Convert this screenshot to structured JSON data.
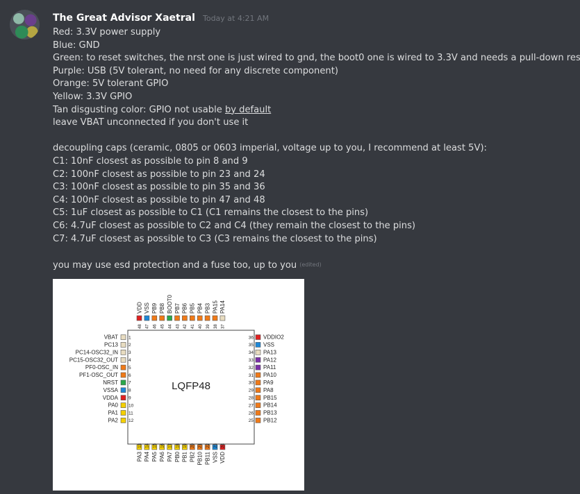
{
  "message": {
    "author": "The Great Advisor Xaetral",
    "timestamp": "Today at 4:21 AM",
    "lines": [
      "Red: 3.3V power supply",
      "Blue: GND",
      "Green: to reset switches, the nrst one is just wired to gnd, the boot0 one is wired to 3.3V and needs a pull-down resistor",
      "Purple: USB (5V tolerant, no need for any discrete component)",
      "Orange: 5V tolerant GPIO",
      "Yellow: 3.3V GPIO"
    ],
    "tan_line_prefix": "Tan disgusting color: GPIO not usable ",
    "tan_line_link": "by default",
    "vbat_line": "leave VBAT unconnected if you don't use it",
    "caps_lines": [
      "decoupling caps (ceramic, 0805 or 0603 imperial, voltage up to you, I recommend at least 5V):",
      "C1: 10nF closest as possible to pin 8 and 9",
      "C2: 100nF closest as possible to pin 23 and 24",
      "C3: 100nF closest as possible to pin 35 and 36",
      "C4: 100nF closest as possible to pin 47 and 48",
      "C5: 1uF closest as possible to C1 (C1 remains the closest to the pins)",
      "C6: 4.7uF closest as possible to C2 and C4 (they remain the closest to the pins)",
      "C7: 4.7uF closest as possible to C3 (C3 remains the closest to the pins)"
    ],
    "esd_line": "you may use esd protection and a fuse too, up to you",
    "edited_label": "(edited)"
  },
  "colors": {
    "red": "#e02020",
    "blue": "#1e88d8",
    "green": "#2aa84a",
    "purple": "#7b2fa8",
    "orange": "#f07a18",
    "yellow": "#f5d000",
    "tan": "#e8dcc0"
  },
  "chip": {
    "package_label": "LQFP48",
    "left_pins": [
      {
        "num": "1",
        "name": "VBAT",
        "color": "tan"
      },
      {
        "num": "2",
        "name": "PC13",
        "color": "tan"
      },
      {
        "num": "3",
        "name": "PC14-OSC32_IN",
        "color": "tan"
      },
      {
        "num": "4",
        "name": "PC15-OSC32_OUT",
        "color": "tan"
      },
      {
        "num": "5",
        "name": "PF0-OSC_IN",
        "color": "orange"
      },
      {
        "num": "6",
        "name": "PF1-OSC_OUT",
        "color": "orange"
      },
      {
        "num": "7",
        "name": "NRST",
        "color": "green"
      },
      {
        "num": "8",
        "name": "VSSA",
        "color": "blue"
      },
      {
        "num": "9",
        "name": "VDDA",
        "color": "red"
      },
      {
        "num": "10",
        "name": "PA0",
        "color": "yellow"
      },
      {
        "num": "11",
        "name": "PA1",
        "color": "yellow"
      },
      {
        "num": "12",
        "name": "PA2",
        "color": "yellow"
      }
    ],
    "bottom_pins": [
      {
        "num": "13",
        "name": "PA3",
        "color": "yellow"
      },
      {
        "num": "14",
        "name": "PA4",
        "color": "yellow"
      },
      {
        "num": "15",
        "name": "PA5",
        "color": "yellow"
      },
      {
        "num": "16",
        "name": "PA6",
        "color": "yellow"
      },
      {
        "num": "17",
        "name": "PA7",
        "color": "yellow"
      },
      {
        "num": "18",
        "name": "PB0",
        "color": "yellow"
      },
      {
        "num": "19",
        "name": "PB1",
        "color": "yellow"
      },
      {
        "num": "20",
        "name": "PB2",
        "color": "orange"
      },
      {
        "num": "21",
        "name": "PB10",
        "color": "orange"
      },
      {
        "num": "22",
        "name": "PB11",
        "color": "orange"
      },
      {
        "num": "23",
        "name": "VSS",
        "color": "blue"
      },
      {
        "num": "24",
        "name": "VDD",
        "color": "red"
      }
    ],
    "right_pins": [
      {
        "num": "36",
        "name": "VDDIO2",
        "color": "red"
      },
      {
        "num": "35",
        "name": "VSS",
        "color": "blue"
      },
      {
        "num": "34",
        "name": "PA13",
        "color": "tan"
      },
      {
        "num": "33",
        "name": "PA12",
        "color": "purple"
      },
      {
        "num": "32",
        "name": "PA11",
        "color": "purple"
      },
      {
        "num": "31",
        "name": "PA10",
        "color": "orange"
      },
      {
        "num": "30",
        "name": "PA9",
        "color": "orange"
      },
      {
        "num": "29",
        "name": "PA8",
        "color": "orange"
      },
      {
        "num": "28",
        "name": "PB15",
        "color": "orange"
      },
      {
        "num": "27",
        "name": "PB14",
        "color": "orange"
      },
      {
        "num": "26",
        "name": "PB13",
        "color": "orange"
      },
      {
        "num": "25",
        "name": "PB12",
        "color": "orange"
      }
    ],
    "top_pins": [
      {
        "num": "48",
        "name": "VDD",
        "color": "red"
      },
      {
        "num": "47",
        "name": "VSS",
        "color": "blue"
      },
      {
        "num": "46",
        "name": "PB9",
        "color": "orange"
      },
      {
        "num": "45",
        "name": "PB8",
        "color": "orange"
      },
      {
        "num": "44",
        "name": "BOOT0",
        "color": "green"
      },
      {
        "num": "43",
        "name": "PB7",
        "color": "orange"
      },
      {
        "num": "42",
        "name": "PB6",
        "color": "orange"
      },
      {
        "num": "41",
        "name": "PB5",
        "color": "orange"
      },
      {
        "num": "40",
        "name": "PB4",
        "color": "orange"
      },
      {
        "num": "39",
        "name": "PB3",
        "color": "orange"
      },
      {
        "num": "38",
        "name": "PA15",
        "color": "orange"
      },
      {
        "num": "37",
        "name": "PA14",
        "color": "tan"
      }
    ]
  }
}
